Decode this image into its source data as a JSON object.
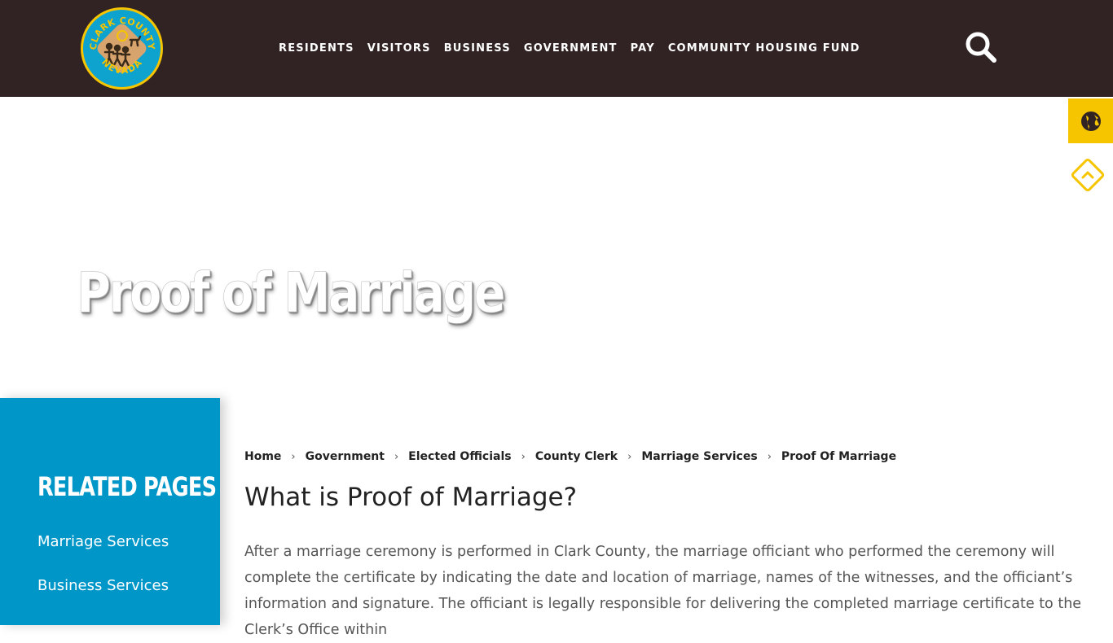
{
  "header": {
    "logo_text_top": "CLARK COUNTY",
    "logo_text_bottom": "NEVADA",
    "nav": [
      {
        "label": "RESIDENTS"
      },
      {
        "label": "VISITORS"
      },
      {
        "label": "BUSINESS"
      },
      {
        "label": "GOVERNMENT"
      },
      {
        "label": "PAY"
      },
      {
        "label": "COMMUNITY HOUSING FUND"
      }
    ],
    "search_icon": "search-icon"
  },
  "side_widgets": {
    "translate_icon": "globe-icon",
    "scroll_top_icon": "chevron-up-icon"
  },
  "hero": {
    "title": "Proof of Marriage"
  },
  "sidebar": {
    "heading": "RELATED PAGES",
    "links": [
      {
        "label": "Marriage Services"
      },
      {
        "label": "Business Services"
      }
    ]
  },
  "breadcrumb": {
    "items": [
      {
        "label": "Home"
      },
      {
        "label": "Government"
      },
      {
        "label": "Elected Officials"
      },
      {
        "label": "County Clerk"
      },
      {
        "label": "Marriage Services"
      }
    ],
    "current": "Proof Of Marriage"
  },
  "content": {
    "heading": "What is Proof of Marriage?",
    "body": "After a marriage ceremony is performed in Clark County, the marriage officiant who performed the ceremony will complete the certificate by indicating the date and location of marriage, names of the witnesses, and the officiant’s information and signature. The officiant is legally responsible for delivering the completed marriage certificate to the Clerk’s Office within"
  },
  "colors": {
    "header_bg": "#312324",
    "accent_yellow": "#f6c500",
    "sidebar_blue": "#0096c8"
  }
}
